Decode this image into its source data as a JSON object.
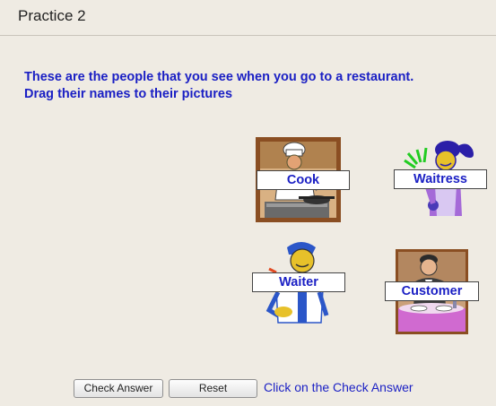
{
  "header": {
    "title": "Practice 2"
  },
  "instructions": {
    "line1": "These are the people that you see when you go to a restaurant.",
    "line2": "Drag their names to their pictures"
  },
  "pictures": [
    {
      "name": "cook",
      "icon": "chef-cooking-icon"
    },
    {
      "name": "waitress",
      "icon": "waitress-icon"
    },
    {
      "name": "waiter",
      "icon": "waiter-icon"
    },
    {
      "name": "customer",
      "icon": "diner-icon"
    }
  ],
  "labels": {
    "cook": "Cook",
    "waitress": "Waitress",
    "waiter": "Waiter",
    "customer": "Customer"
  },
  "buttons": {
    "check_answer": "Check Answer",
    "reset": "Reset"
  },
  "hint": "Click on the Check Answer",
  "colors": {
    "background": "#efebe3",
    "instruction_text": "#1a1fc4",
    "label_text": "#1a1fc4"
  }
}
